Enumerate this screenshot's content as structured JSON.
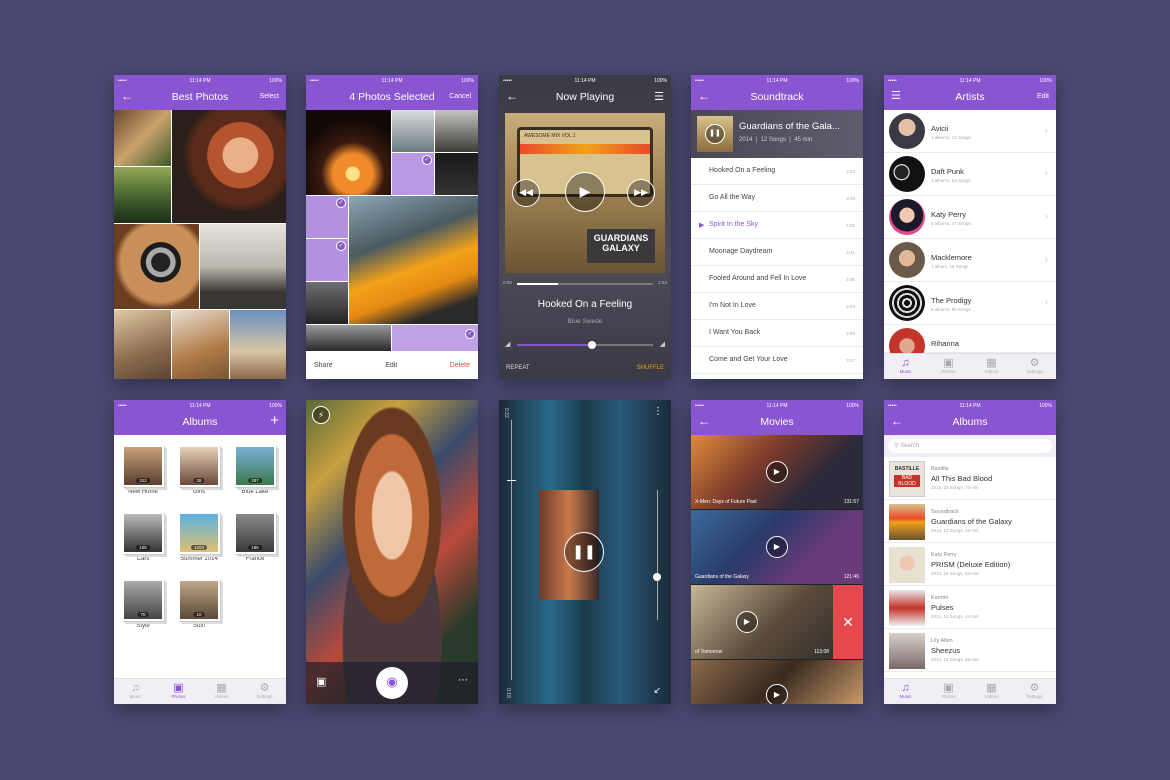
{
  "status": {
    "time": "11:14 PM",
    "battery": "100%",
    "carrier": "•••••"
  },
  "s1": {
    "title": "Best Photos",
    "right": "Select"
  },
  "s2": {
    "title": "4 Photos Selected",
    "right": "Cancel",
    "share": "Share",
    "edit": "Edit",
    "delete": "Delete"
  },
  "s3": {
    "title": "Now Playing",
    "song": "Hooked On a Feeling",
    "artist": "Blue Swede",
    "elapsed": "0:59",
    "total": "1:53",
    "repeat": "REPEAT",
    "shuffle": "SHUFFLE",
    "tape": "AWESOME MIX VOL.1",
    "logo1": "GUARDIANS",
    "logo2": "GALAXY",
    "progress": 0.3,
    "volume": 0.55
  },
  "s4": {
    "title": "Soundtrack",
    "album": "Guardians of the Gala...",
    "meta": [
      "2014",
      "12 Songs",
      "45 min"
    ],
    "songs": [
      {
        "t": "Hooked On a Feeling",
        "d": "2:53"
      },
      {
        "t": "Go All the Way",
        "d": "3:25"
      },
      {
        "t": "Spirit In the Sky",
        "d": "4:02"
      },
      {
        "t": "Moonage Daydream",
        "d": "4:41"
      },
      {
        "t": "Fooled Around and Fell In Love",
        "d": "4:36"
      },
      {
        "t": "I'm Not In Love",
        "d": "6:03"
      },
      {
        "t": "I Want You Back",
        "d": "2:59"
      },
      {
        "t": "Come and Get Your Love",
        "d": "3:27"
      }
    ]
  },
  "s5": {
    "title": "Artists",
    "right": "Edit",
    "artists": [
      {
        "name": "Avicii",
        "sub": "1 albums, 12 Songs"
      },
      {
        "name": "Daft Punk",
        "sub": "4 albums, 54 Songs"
      },
      {
        "name": "Katy Perry",
        "sub": "3 albums, 47 Songs"
      },
      {
        "name": "Macklemore",
        "sub": "1 album, 18 Songs"
      },
      {
        "name": "The Prodigy",
        "sub": "6 albums, 90 Songs"
      },
      {
        "name": "Rihanna",
        "sub": ""
      }
    ]
  },
  "tabs": [
    "Music",
    "Photos",
    "Videos",
    "Settings"
  ],
  "s6": {
    "title": "Albums",
    "albums": [
      {
        "name": "New Home",
        "count": "312"
      },
      {
        "name": "Girls",
        "count": "28"
      },
      {
        "name": "Blue Lake",
        "count": "287"
      },
      {
        "name": "Cars",
        "count": "105"
      },
      {
        "name": "Summer 2014",
        "count": "1203"
      },
      {
        "name": "France",
        "count": "186"
      },
      {
        "name": "Style",
        "count": "70"
      },
      {
        "name": "Stuff",
        "count": "10"
      }
    ]
  },
  "s8": {
    "left_time": "0:22",
    "right_time": "0:18"
  },
  "s9": {
    "title": "Movies",
    "movies": [
      {
        "title": "X-Men: Days of Future Past",
        "dur": "131:57"
      },
      {
        "title": "Guardians of the Galaxy",
        "dur": "121:46"
      },
      {
        "title": "of Tomorrow",
        "dur": "113:08"
      }
    ]
  },
  "s10": {
    "title": "Albums",
    "search": "Search",
    "albums": [
      {
        "artist": "Bastille",
        "title": "All This Bad Blood",
        "meta": "2013, 25 Songs, 73 min",
        "cover_text": "BASTILLE",
        "cover_sub": "BAD BLOOD"
      },
      {
        "artist": "Soundtrack",
        "title": "Guardians of the Galaxy",
        "meta": "2014, 12 Songs, 45 min"
      },
      {
        "artist": "Katy Perry",
        "title": "PRISM (Deluxe Edition)",
        "meta": "2013, 16 Songs, 63 min"
      },
      {
        "artist": "Karmin",
        "title": "Pulses",
        "meta": "2014, 12 Songs, 44 min"
      },
      {
        "artist": "Lily Allen",
        "title": "Sheezus",
        "meta": "2014, 14 Songs, 58 min"
      }
    ]
  }
}
